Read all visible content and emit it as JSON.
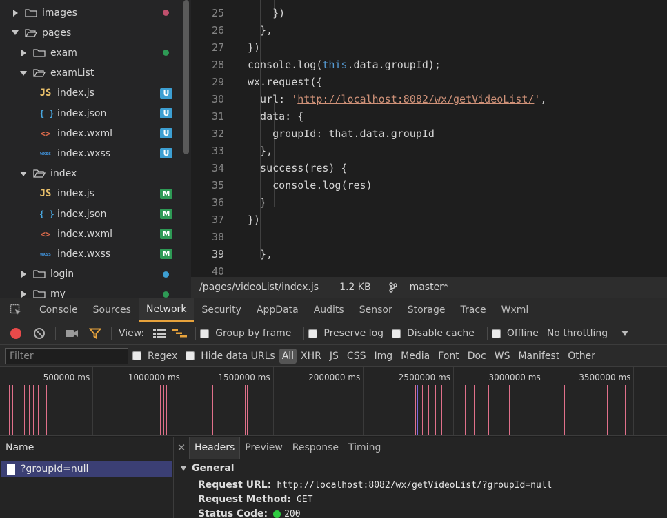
{
  "tree": {
    "items": [
      {
        "label": "images",
        "kind": "folder",
        "state": "collapsed",
        "marker": "dot",
        "marker_color": "#c0506d"
      },
      {
        "label": "pages",
        "kind": "folder",
        "state": "expanded"
      },
      {
        "label": "exam",
        "kind": "folder",
        "state": "collapsed",
        "marker": "dot",
        "marker_color": "#2e9a55"
      },
      {
        "label": "examList",
        "kind": "folder",
        "state": "expanded"
      },
      {
        "label": "index.js",
        "kind": "js",
        "marker": "U"
      },
      {
        "label": "index.json",
        "kind": "json",
        "marker": "U"
      },
      {
        "label": "index.wxml",
        "kind": "wxml",
        "marker": "U"
      },
      {
        "label": "index.wxss",
        "kind": "wxss",
        "marker": "U"
      },
      {
        "label": "index",
        "kind": "folder",
        "state": "expanded"
      },
      {
        "label": "index.js",
        "kind": "js",
        "marker": "M"
      },
      {
        "label": "index.json",
        "kind": "json",
        "marker": "M"
      },
      {
        "label": "index.wxml",
        "kind": "wxml",
        "marker": "M"
      },
      {
        "label": "index.wxss",
        "kind": "wxss",
        "marker": "M"
      },
      {
        "label": "login",
        "kind": "folder",
        "state": "collapsed",
        "marker": "dot",
        "marker_color": "#3d9fd2"
      },
      {
        "label": "my",
        "kind": "folder",
        "state": "collapsed",
        "marker": "dot",
        "marker_color": "#2e9a55"
      }
    ],
    "icon_glyphs": {
      "js": "JS",
      "json": "{ }",
      "wxml": "<>",
      "wxss": "wxss"
    }
  },
  "editor": {
    "lines": [
      {
        "n": "25",
        "code": "        })"
      },
      {
        "n": "26",
        "code": "      },"
      },
      {
        "n": "27",
        "code": "    })"
      },
      {
        "n": "28",
        "code": "    console.log(this.data.groupId);"
      },
      {
        "n": "29",
        "code": "    wx.request({"
      },
      {
        "n": "30",
        "code": "      url: 'http://localhost:8082/wx/getVideoList/',"
      },
      {
        "n": "31",
        "code": "      data: {"
      },
      {
        "n": "32",
        "code": "        groupId: that.data.groupId"
      },
      {
        "n": "33",
        "code": "      },"
      },
      {
        "n": "34",
        "code": "      success(res) {"
      },
      {
        "n": "35",
        "code": "        console.log(res)"
      },
      {
        "n": "36",
        "code": "      }"
      },
      {
        "n": "37",
        "code": "    })"
      },
      {
        "n": "38",
        "code": ""
      },
      {
        "n": "39",
        "code": "  },"
      },
      {
        "n": "40",
        "code": ""
      }
    ],
    "current_line": "39"
  },
  "statusbar": {
    "path": "/pages/videoList/index.js",
    "size": "1.2 KB",
    "branch": "master*"
  },
  "devtools": {
    "tabs": [
      "Console",
      "Sources",
      "Network",
      "Security",
      "AppData",
      "Audits",
      "Sensor",
      "Storage",
      "Trace",
      "Wxml"
    ],
    "active_tab": "Network"
  },
  "network_toolbar": {
    "view_label": "View:",
    "group_by_frame": "Group by frame",
    "preserve_log": "Preserve log",
    "disable_cache": "Disable cache",
    "offline": "Offline",
    "throttling": "No throttling"
  },
  "filter_bar": {
    "placeholder": "Filter",
    "regex": "Regex",
    "hide_data_urls": "Hide data URLs",
    "types": [
      "All",
      "XHR",
      "JS",
      "CSS",
      "Img",
      "Media",
      "Font",
      "Doc",
      "WS",
      "Manifest",
      "Other"
    ],
    "active_type": "All"
  },
  "timeline": {
    "ticks": [
      "500000 ms",
      "1000000 ms",
      "1500000 ms",
      "2000000 ms",
      "2500000 ms",
      "3000000 ms",
      "3500000 ms"
    ],
    "bar_color": "#e0708a",
    "accent_color": "#7b68d8"
  },
  "requests": {
    "header": "Name",
    "items": [
      "?groupId=null"
    ]
  },
  "details": {
    "tabs": [
      "Headers",
      "Preview",
      "Response",
      "Timing"
    ],
    "active_tab": "Headers",
    "section": "General",
    "fields": [
      {
        "key": "Request URL:",
        "value": "http://localhost:8082/wx/getVideoList/?groupId=null"
      },
      {
        "key": "Request Method:",
        "value": "GET"
      },
      {
        "key": "Status Code:",
        "value": "200"
      }
    ]
  }
}
